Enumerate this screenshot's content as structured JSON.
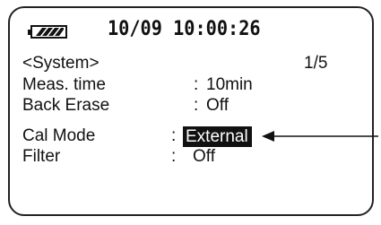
{
  "status": {
    "battery_icon": "battery-full-icon",
    "datetime": "10/09 10:00:26"
  },
  "screen": {
    "title": "<System>",
    "page": "1",
    "page_total": "5",
    "page_sep": "/"
  },
  "settings": [
    {
      "label": "Meas.  time",
      "sep": ":",
      "value": "10min"
    },
    {
      "label": "Back Erase",
      "sep": ":",
      "value": "Off"
    },
    {
      "label": "Cal Mode",
      "sep": ":",
      "value": "External",
      "selected": true
    },
    {
      "label": "Filter",
      "sep": ":",
      "value": "Off"
    }
  ],
  "colors": {
    "text": "#111111",
    "highlight_bg": "#111111",
    "highlight_fg": "#ffffff"
  }
}
